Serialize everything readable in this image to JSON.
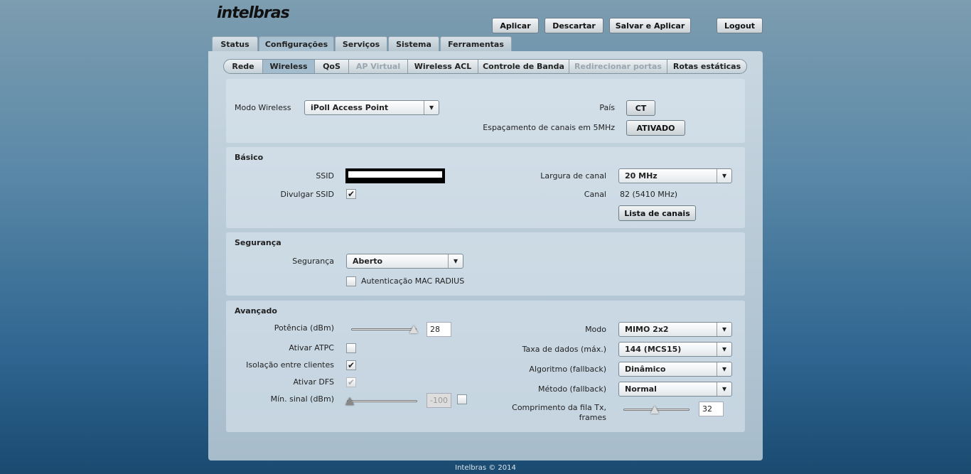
{
  "brand": "intelbras",
  "header": {
    "apply": "Aplicar",
    "discard": "Descartar",
    "save_apply": "Salvar e Aplicar",
    "logout": "Logout"
  },
  "tabs": [
    "Status",
    "Configurações",
    "Serviços",
    "Sistema",
    "Ferramentas"
  ],
  "subtabs": [
    "Rede",
    "Wireless",
    "QoS",
    "AP Virtual",
    "Wireless ACL",
    "Controle de Banda",
    "Redirecionar portas",
    "Rotas estáticas"
  ],
  "top": {
    "mode_label": "Modo Wireless",
    "mode_value": "iPoll Access Point",
    "country_label": "País",
    "country_value": "CT",
    "spacing_label": "Espaçamento de canais em 5MHz",
    "spacing_value": "ATIVADO"
  },
  "basic": {
    "title": "Básico",
    "ssid_label": "SSID",
    "ssid_value": "",
    "broadcast_label": "Divulgar SSID",
    "width_label": "Largura de canal",
    "width_value": "20 MHz",
    "channel_label": "Canal",
    "channel_value": "82 (5410 MHz)",
    "channel_list": "Lista de canais"
  },
  "security": {
    "title": "Segurança",
    "label": "Segurança",
    "value": "Aberto",
    "mac_radius": "Autenticação MAC RADIUS"
  },
  "advanced": {
    "title": "Avançado",
    "power_label": "Potência (dBm)",
    "power_value": "28",
    "atpc_label": "Ativar ATPC",
    "isolation_label": "Isolação entre clientes",
    "dfs_label": "Ativar DFS",
    "minsig_label": "Mín. sinal (dBm)",
    "minsig_value": "-100",
    "mode_label": "Modo",
    "mode_value": "MIMO 2x2",
    "rate_label": "Taxa de dados (máx.)",
    "rate_value": "144 (MCS15)",
    "algo_label": "Algoritmo (fallback)",
    "algo_value": "Dinâmico",
    "method_label": "Método (fallback)",
    "method_value": "Normal",
    "queue_label1": "Comprimento da fila Tx,",
    "queue_label2": "frames",
    "queue_value": "32"
  },
  "footer": "Intelbras © 2014"
}
